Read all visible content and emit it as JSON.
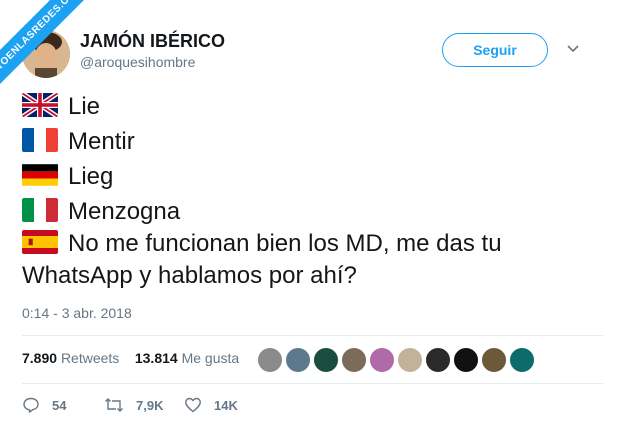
{
  "watermark": "VISTOENLASREDES.COM",
  "user": {
    "name": "JAMÓN IBÉRICO",
    "handle": "@aroquesihombre"
  },
  "follow_label": "Seguir",
  "tweet": {
    "lines": [
      {
        "flag": "uk-flag-icon",
        "text": "Lie"
      },
      {
        "flag": "france-flag-icon",
        "text": "Mentir"
      },
      {
        "flag": "germany-flag-icon",
        "text": "Lieg"
      },
      {
        "flag": "italy-flag-icon",
        "text": "Menzogna"
      },
      {
        "flag": "spain-flag-icon",
        "text": "No me funcionan bien los MD, me das tu"
      }
    ],
    "continuation": "WhatsApp y hablamos por ahí?"
  },
  "timestamp": "0:14 - 3 abr. 2018",
  "stats": {
    "retweets_count": "7.890",
    "retweets_label": "Retweets",
    "likes_count": "13.814",
    "likes_label": "Me gusta"
  },
  "actions": {
    "replies": "54",
    "retweets": "7,9K",
    "likes": "14K"
  },
  "colors": {
    "accent": "#1da1f2",
    "secondary_text": "#657786"
  }
}
